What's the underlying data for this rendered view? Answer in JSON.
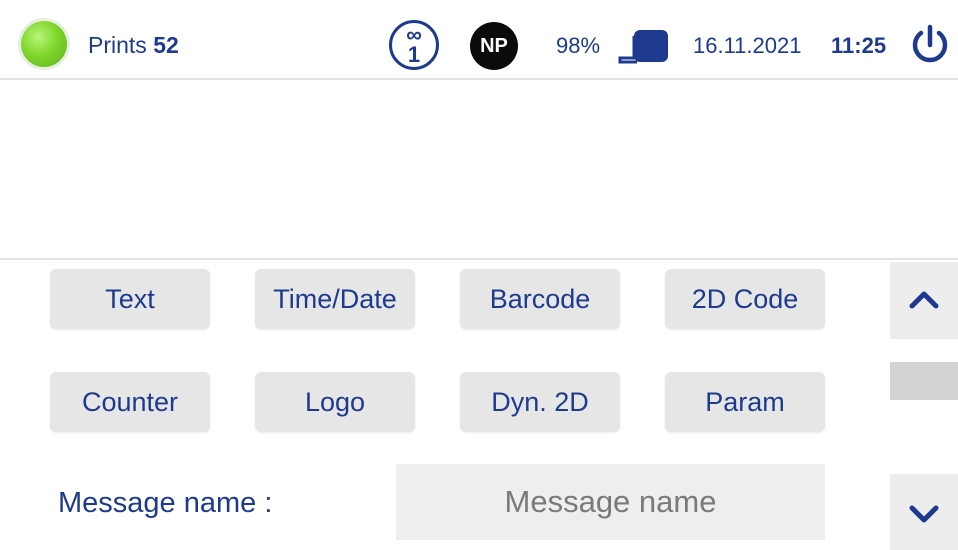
{
  "status_bar": {
    "prints_label": "Prints",
    "prints_count": "52",
    "counter_badge_top": "∞",
    "counter_badge_bottom": "1",
    "np_badge": "NP",
    "ink_level": "98%",
    "date": "16.11.2021",
    "time": "11:25",
    "status_color": "#7fd62c",
    "icons": [
      "status-led-icon",
      "infinity-counter-icon",
      "np-badge-icon",
      "cartridge-icon",
      "power-icon"
    ]
  },
  "object_buttons": {
    "row1": [
      "Text",
      "Time/Date",
      "Barcode",
      "2D Code"
    ],
    "row2": [
      "Counter",
      "Logo",
      "Dyn. 2D",
      "Param"
    ]
  },
  "message": {
    "label": "Message name :",
    "placeholder": "Message name",
    "value": ""
  },
  "colors": {
    "accent": "#1e3a8f",
    "button_bg": "#e6e6e6"
  }
}
